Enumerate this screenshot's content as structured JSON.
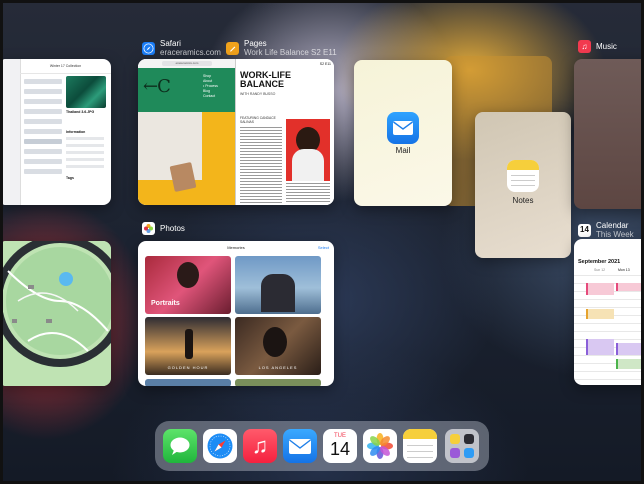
{
  "apps": {
    "safari": {
      "name": "Safari",
      "subtitle": "eraceramics.com",
      "url_bar": "eraceramics.com",
      "menu": [
        "Shop",
        "About",
        "• Process",
        "Blog",
        "Contact"
      ],
      "logo_text": "←C"
    },
    "pages": {
      "name": "Pages",
      "subtitle": "Work Life Balance S2 E11",
      "doc_title": "WORK-LIFE BALANCE",
      "byline_1": "WITH RANDY BUSSO",
      "byline_2": "FEATURING CANDACE SALINAS",
      "page_number": "S2 E11"
    },
    "files": {
      "window_title": "Winter 17 Collection",
      "file_name": "Thailand 3.6.JPG",
      "section_info": "Information",
      "section_tags": "Tags"
    },
    "music": {
      "name": "Music"
    },
    "mail": {
      "name": "Mail"
    },
    "notes": {
      "name": "Notes"
    },
    "photos": {
      "name": "Photos",
      "title": "Memories",
      "action": "Select",
      "tiles": [
        "Portraits",
        "GOLDEN HOUR",
        "LOS ANGELES"
      ]
    },
    "calendar": {
      "name": "Calendar",
      "subtitle": "This Week",
      "month": "September 2021",
      "day1": "Sun 12",
      "day2": "Mon 13"
    }
  },
  "dock": {
    "apps": [
      "messages-icon",
      "safari-icon",
      "music-icon",
      "mail-icon",
      "calendar-icon",
      "photos-icon",
      "notes-icon",
      "app-library-icon"
    ],
    "calendar_day": "TUE",
    "calendar_date": "14"
  },
  "icon_badges": {
    "calendar_header": "14"
  },
  "colors": {
    "safari": "#1a7cf5",
    "pages": "#f1a21c",
    "music": "#f23a4f",
    "mail": "#2a8bf0",
    "notes": "#f6cf3b",
    "calendar": "#ffffff",
    "messages": "#2ecc48",
    "safari_page_bg": "#1f8a5a",
    "safari_accent": "#f3b51b"
  }
}
